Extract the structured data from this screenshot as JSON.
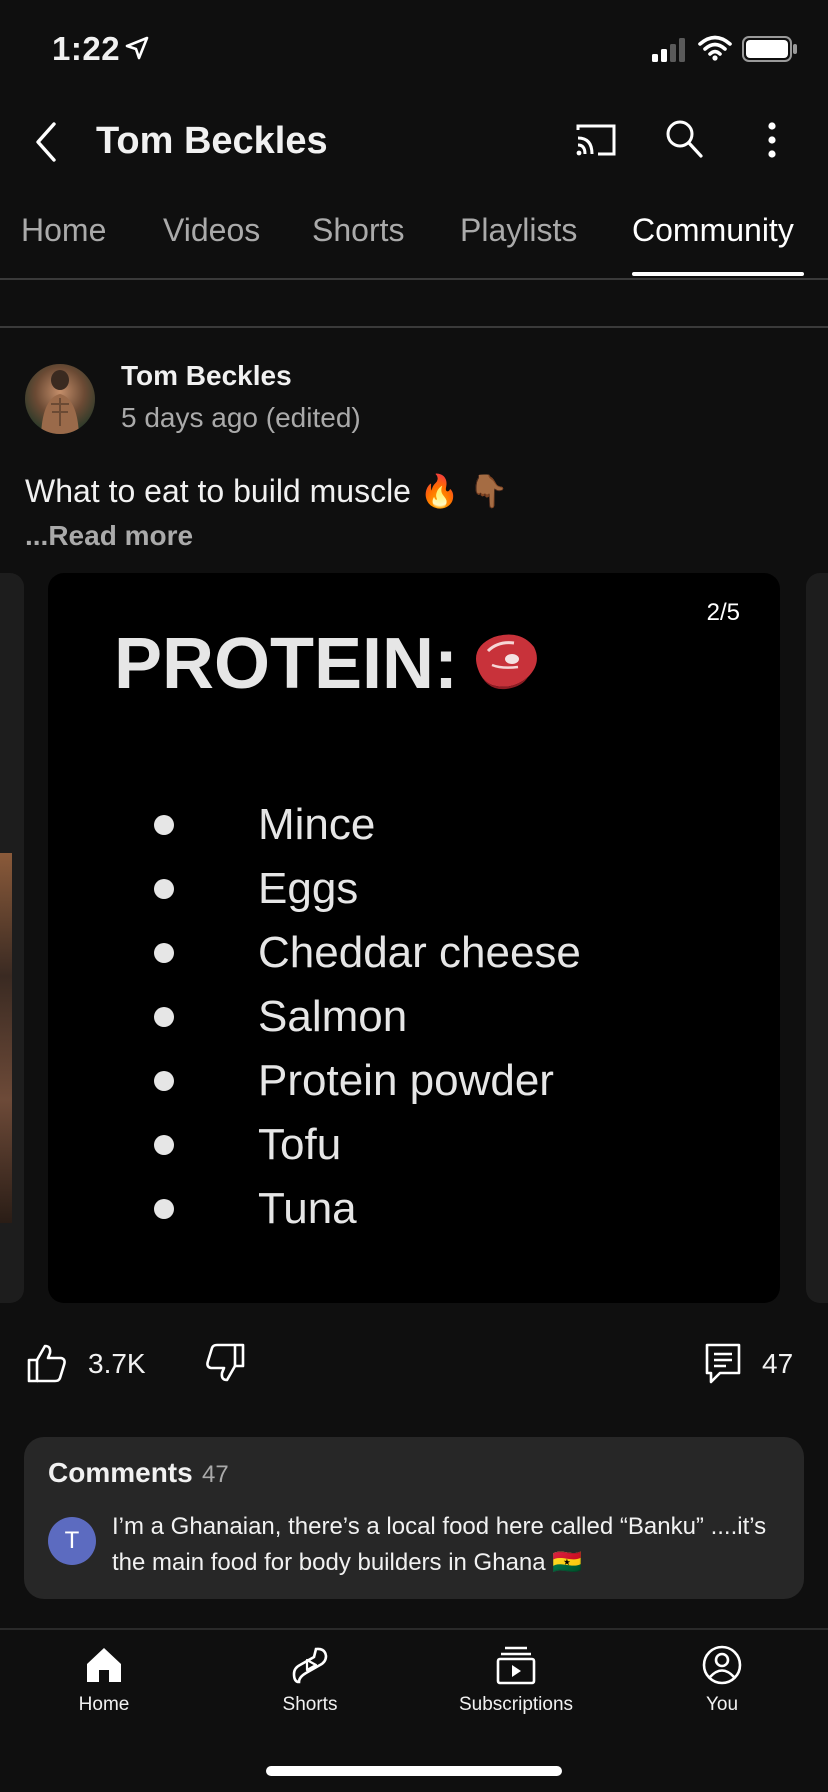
{
  "status_bar": {
    "time": "1:22"
  },
  "header": {
    "title": "Tom Beckles"
  },
  "tabs": [
    {
      "label": "Home"
    },
    {
      "label": "Videos"
    },
    {
      "label": "Shorts"
    },
    {
      "label": "Playlists"
    },
    {
      "label": "Community",
      "active": true
    }
  ],
  "post": {
    "author": "Tom Beckles",
    "meta": "5 days ago (edited)",
    "text": "What to eat to build muscle 🔥 👇🏾",
    "read_more": "...Read more",
    "slide": {
      "counter": "2/5",
      "heading": "PROTEIN:",
      "items": [
        "Mince",
        "Eggs",
        "Cheddar cheese",
        "Salmon",
        "Protein powder",
        "Tofu",
        "Tuna"
      ]
    },
    "likes": "3.7K",
    "comments_count": "47"
  },
  "comments": {
    "title": "Comments",
    "count": "47",
    "top_comment": {
      "avatar_letter": "T",
      "text": "I’m a Ghanaian, there’s a local food here called “Banku” ....it’s the main food for body builders in Ghana 🇬🇭"
    }
  },
  "bottom_nav": [
    {
      "label": "Home",
      "icon": "home-icon",
      "active": true
    },
    {
      "label": "Shorts",
      "icon": "shorts-icon"
    },
    {
      "label": "Subscriptions",
      "icon": "subscriptions-icon"
    },
    {
      "label": "You",
      "icon": "account-icon"
    }
  ],
  "colors": {
    "background": "#0f0f0f",
    "card": "#272727",
    "avatar_accent": "#5c6bc0",
    "muted_text": "#aaaaaa"
  }
}
